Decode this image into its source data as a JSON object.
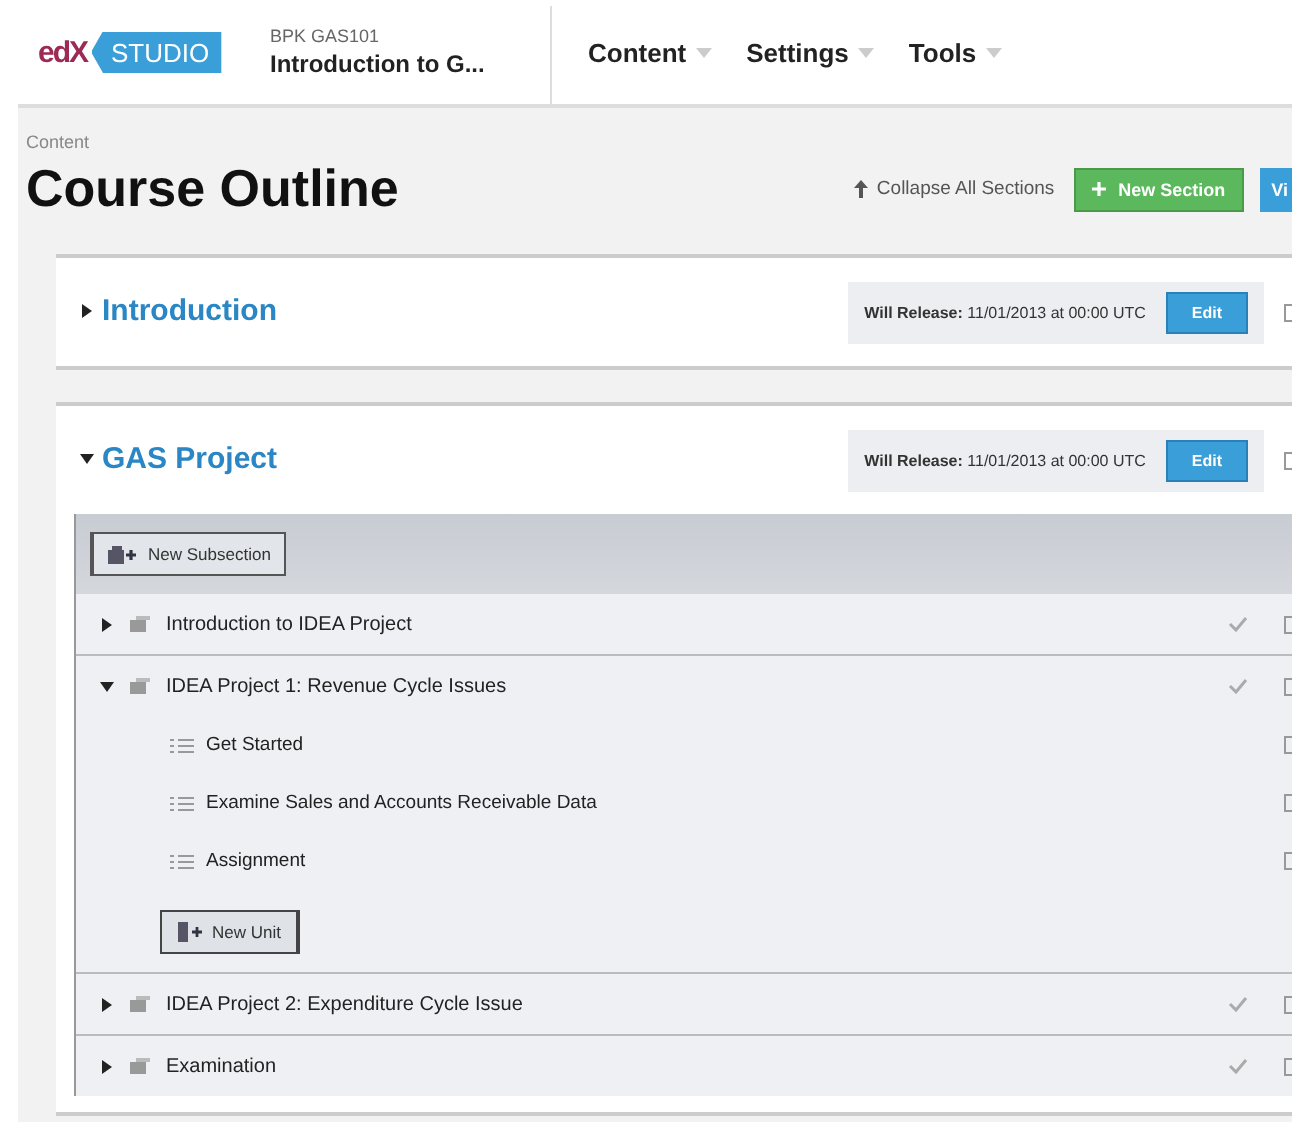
{
  "header": {
    "logo": {
      "brand": "edX",
      "product": "STUDIO"
    },
    "course_code": "BPK GAS101",
    "course_title": "Introduction to G...",
    "nav": [
      {
        "label": "Content"
      },
      {
        "label": "Settings"
      },
      {
        "label": "Tools"
      }
    ]
  },
  "breadcrumb": "Content",
  "page_title": "Course Outline",
  "actions": {
    "collapse": "Collapse All Sections",
    "new_section": "New Section",
    "view": "Vi"
  },
  "sections": [
    {
      "title": "Introduction",
      "expanded": false,
      "release_label": "Will Release:",
      "release_value": "11/01/2013 at 00:00 UTC",
      "edit": "Edit"
    },
    {
      "title": "GAS Project",
      "expanded": true,
      "release_label": "Will Release:",
      "release_value": "11/01/2013 at 00:00 UTC",
      "edit": "Edit",
      "new_subsection": "New Subsection",
      "subsections": [
        {
          "title": "Introduction to IDEA Project",
          "expanded": false
        },
        {
          "title": "IDEA Project 1: Revenue Cycle Issues",
          "expanded": true,
          "new_unit": "New Unit",
          "units": [
            {
              "title": "Get Started"
            },
            {
              "title": "Examine Sales and Accounts Receivable Data"
            },
            {
              "title": "Assignment"
            }
          ]
        },
        {
          "title": "IDEA Project 2: Expenditure Cycle Issue",
          "expanded": false
        },
        {
          "title": "Examination",
          "expanded": false
        }
      ]
    }
  ]
}
